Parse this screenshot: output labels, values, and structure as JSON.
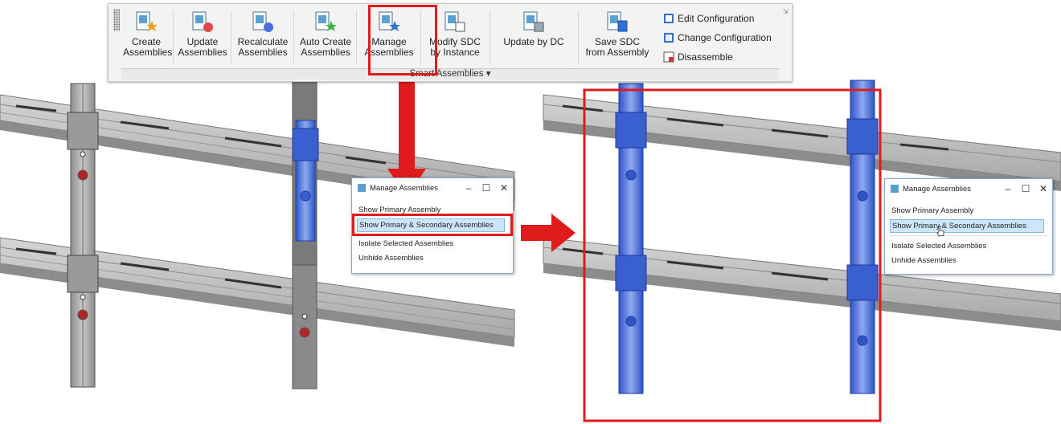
{
  "ribbon": {
    "buttons": [
      {
        "label": "Create\nAssemblies",
        "icon": "create-assemblies-icon"
      },
      {
        "label": "Update\nAssemblies",
        "icon": "update-assemblies-icon"
      },
      {
        "label": "Recalculate\nAssemblies",
        "icon": "recalculate-assemblies-icon"
      },
      {
        "label": "Auto Create\nAssemblies",
        "icon": "auto-create-assemblies-icon"
      },
      {
        "label": "Manage\nAssemblies",
        "icon": "manage-assemblies-icon"
      },
      {
        "label": "Modify SDC\nby Instance",
        "icon": "modify-sdc-icon"
      },
      {
        "label": "Update by DC",
        "icon": "update-by-dc-icon"
      },
      {
        "label": "Save SDC\nfrom Assembly",
        "icon": "save-sdc-icon"
      }
    ],
    "small_buttons": [
      {
        "label": "Edit Configuration",
        "icon": "edit-configuration-icon"
      },
      {
        "label": "Change Configuration",
        "icon": "change-configuration-icon"
      },
      {
        "label": "Disassemble",
        "icon": "disassemble-icon"
      }
    ],
    "panel_title": "Smart Assemblies ▾"
  },
  "dialog_left": {
    "title": "Manage Assemblies",
    "minimize": "–",
    "maximize": "☐",
    "close": "✕",
    "items": [
      "Show Primary Assembly",
      "Show Primary & Secondary Assemblies",
      "Isolate Selected Assemblies",
      "Unhide Assemblies"
    ],
    "selected_index": 1
  },
  "dialog_right": {
    "title": "Manage Assemblies",
    "minimize": "–",
    "maximize": "☐",
    "close": "✕",
    "items": [
      "Show Primary Assembly",
      "Show Primary & Secondary Assemblies",
      "Isolate Selected Assemblies",
      "Unhide Assemblies"
    ],
    "selected_index": 1
  },
  "colors": {
    "highlight": "#e01b1b",
    "selection_blue": "#3d63d6",
    "concrete": "#b9b9b9"
  }
}
